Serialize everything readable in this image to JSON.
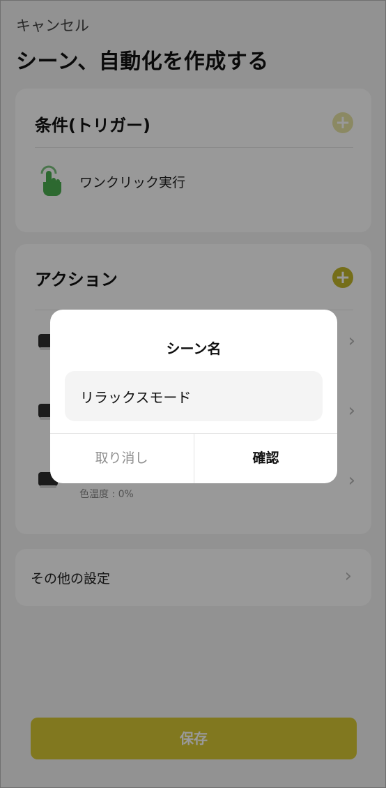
{
  "header": {
    "cancel_label": "キャンセル",
    "title": "シーン、自動化を作成する"
  },
  "trigger_card": {
    "heading": "条件(トリガー)",
    "add_icon": "plus-circle-icon",
    "item": {
      "icon": "tap-hand-icon",
      "label": "ワンクリック実行"
    }
  },
  "action_card": {
    "heading": "アクション",
    "add_icon": "plus-circle-icon",
    "items": [
      {
        "icon": "ceiling-light-icon",
        "detail": ""
      },
      {
        "icon": "ceiling-light-icon",
        "detail": ""
      },
      {
        "icon": "ceiling-light-icon",
        "detail": "色温度 : 0%"
      }
    ]
  },
  "other_settings": {
    "label": "その他の設定"
  },
  "footer": {
    "save_label": "保存"
  },
  "dialog": {
    "title": "シーン名",
    "input_value": "リラックスモード",
    "cancel_label": "取り消し",
    "confirm_label": "確認"
  },
  "colors": {
    "accent": "#c4b72a",
    "save_button": "#d7c935",
    "icon_green": "#4caf50"
  }
}
